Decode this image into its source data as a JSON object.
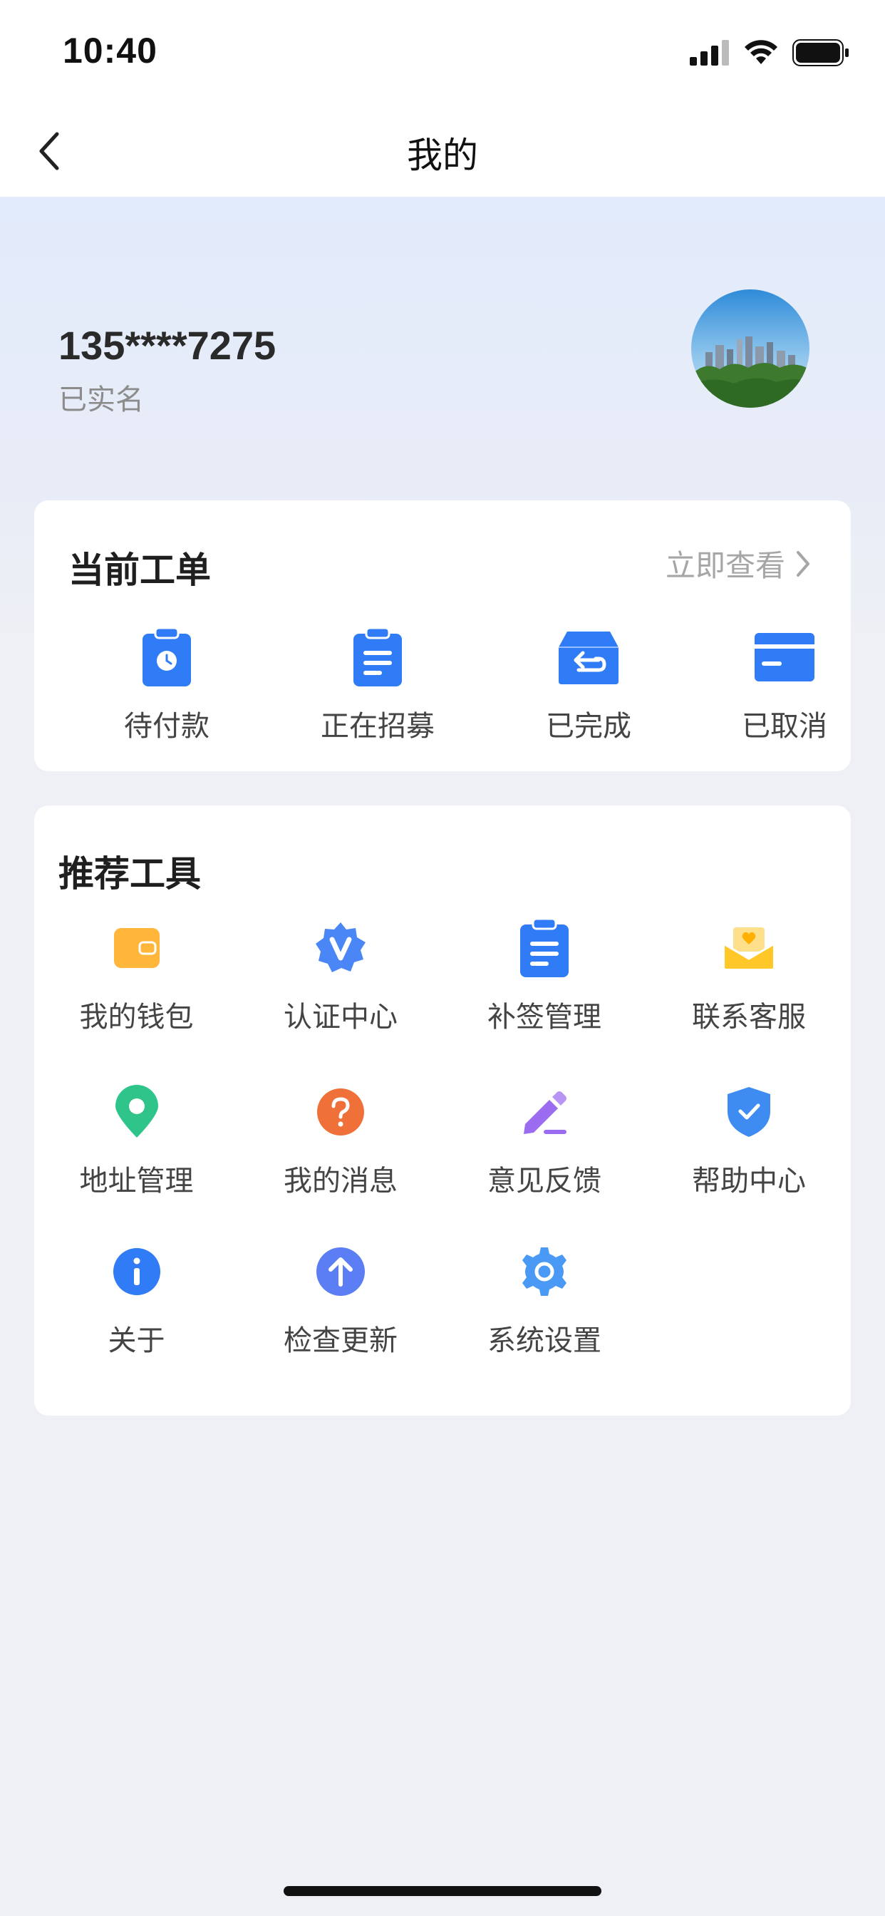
{
  "status_bar": {
    "time": "10:40"
  },
  "nav": {
    "title": "我的",
    "back_icon": "chevron-left-icon"
  },
  "profile": {
    "phone": "135****7275",
    "verification_status": "已实名",
    "avatar": "city-skyline-avatar"
  },
  "orders": {
    "title": "当前工单",
    "view_all_label": "立即查看",
    "items": [
      {
        "label": "待付款",
        "icon": "clipboard-clock-icon",
        "color": "#2f7cf6"
      },
      {
        "label": "正在招募",
        "icon": "document-list-icon",
        "color": "#2f7cf6"
      },
      {
        "label": "已完成",
        "icon": "tray-return-icon",
        "color": "#2f7cf6"
      },
      {
        "label": "已取消",
        "icon": "card-icon",
        "color": "#2f7cf6"
      }
    ]
  },
  "tools": {
    "title": "推荐工具",
    "items": [
      {
        "label": "我的钱包",
        "icon": "wallet-icon",
        "color": "#ffb63a"
      },
      {
        "label": "认证中心",
        "icon": "verified-badge-icon",
        "color": "#4a86f5"
      },
      {
        "label": "补签管理",
        "icon": "clipboard-icon",
        "color": "#2f7cf6"
      },
      {
        "label": "联系客服",
        "icon": "mail-heart-icon",
        "color": "#ffc727"
      },
      {
        "label": "地址管理",
        "icon": "location-pin-icon",
        "color": "#2fc48a"
      },
      {
        "label": "我的消息",
        "icon": "question-circle-icon",
        "color": "#f0703a"
      },
      {
        "label": "意见反馈",
        "icon": "pencil-icon",
        "color": "#9b6cf0"
      },
      {
        "label": "帮助中心",
        "icon": "shield-check-icon",
        "color": "#3e8cf2"
      },
      {
        "label": "关于",
        "icon": "info-circle-icon",
        "color": "#2f7cf6"
      },
      {
        "label": "检查更新",
        "icon": "arrow-up-circle-icon",
        "color": "#5c7ef5"
      },
      {
        "label": "系统设置",
        "icon": "gear-icon",
        "color": "#4a9af5"
      }
    ]
  }
}
